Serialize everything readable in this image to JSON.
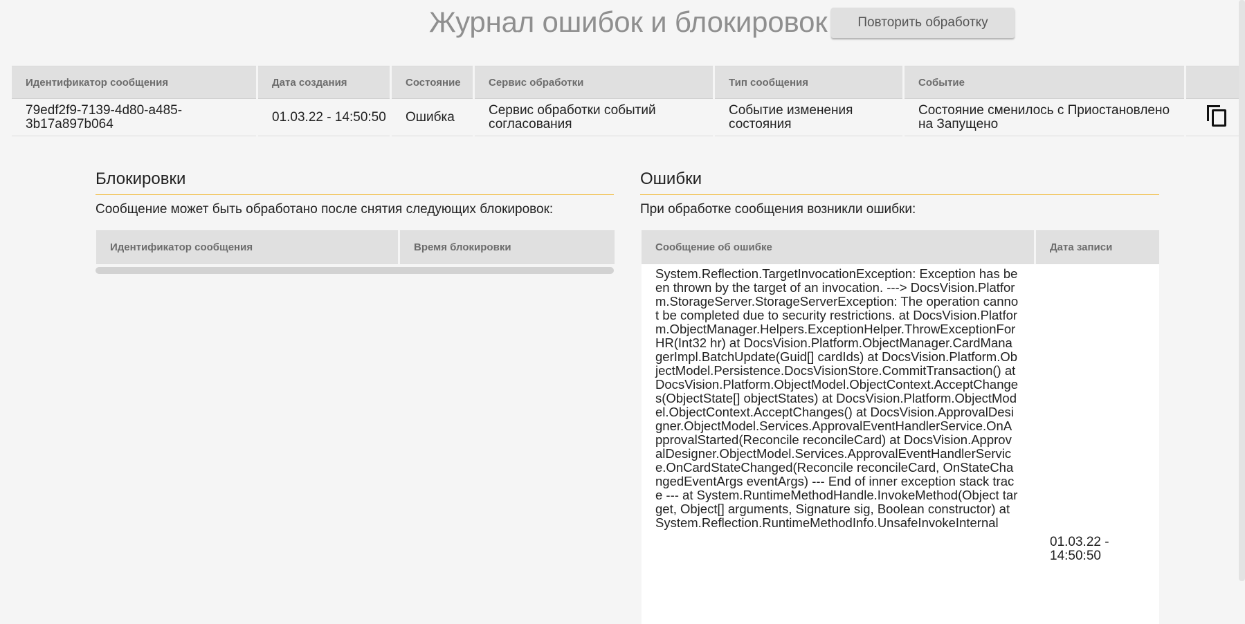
{
  "header": {
    "title": "Журнал ошибок и блокировок",
    "retry_button": "Повторить обработку"
  },
  "main_table": {
    "columns": [
      "Идентификатор сообщения",
      "Дата создания",
      "Состояние",
      "Сервис обработки",
      "Тип сообщения",
      "Событие",
      ""
    ],
    "row": {
      "message_id": "79edf2f9-7139-4d80-a485-3b17a897b064",
      "created": "01.03.22 - 14:50:50",
      "state": "Ошибка",
      "service": "Сервис обработки событий согласования",
      "message_type": "Событие изменения состояния",
      "event": "Состояние сменилось с Приостановлено на Запущено",
      "copy_icon": "copy-icon"
    }
  },
  "locks": {
    "title": "Блокировки",
    "description": "Сообщение может быть обработано после снятия следующих блокировок:",
    "columns": [
      "Идентификатор сообщения",
      "Время блокировки"
    ]
  },
  "errors": {
    "title": "Ошибки",
    "description": "При обработке сообщения возникли ошибки:",
    "columns": [
      "Сообщение об ошибке",
      "Дата записи"
    ],
    "rows": [
      {
        "message": "System.Reflection.TargetInvocationException: Exception has been thrown by the target of an invocation. ---> DocsVision.Platform.StorageServer.StorageServerException: The operation cannot be completed due to security restrictions. at DocsVision.Platform.ObjectManager.Helpers.ExceptionHelper.ThrowExceptionForHR(Int32 hr) at DocsVision.Platform.ObjectManager.CardManagerImpl.BatchUpdate(Guid[] cardIds) at DocsVision.Platform.ObjectModel.Persistence.DocsVisionStore.CommitTransaction() at DocsVision.Platform.ObjectModel.ObjectContext.AcceptChanges(ObjectState[] objectStates) at DocsVision.Platform.ObjectModel.ObjectContext.AcceptChanges() at DocsVision.ApprovalDesigner.ObjectModel.Services.ApprovalEventHandlerService.OnApprovalStarted(Reconcile reconcileCard) at DocsVision.ApprovalDesigner.ObjectModel.Services.ApprovalEventHandlerService.OnCardStateChanged(Reconcile reconcileCard, OnStateChangedEventArgs eventArgs) --- End of inner exception stack trace --- at System.RuntimeMethodHandle.InvokeMethod(Object target, Object[] arguments, Signature sig, Boolean constructor) at System.Reflection.RuntimeMethodInfo.UnsafeInvokeInternal",
        "date": "01.03.22 - 14:50:50"
      }
    ]
  }
}
